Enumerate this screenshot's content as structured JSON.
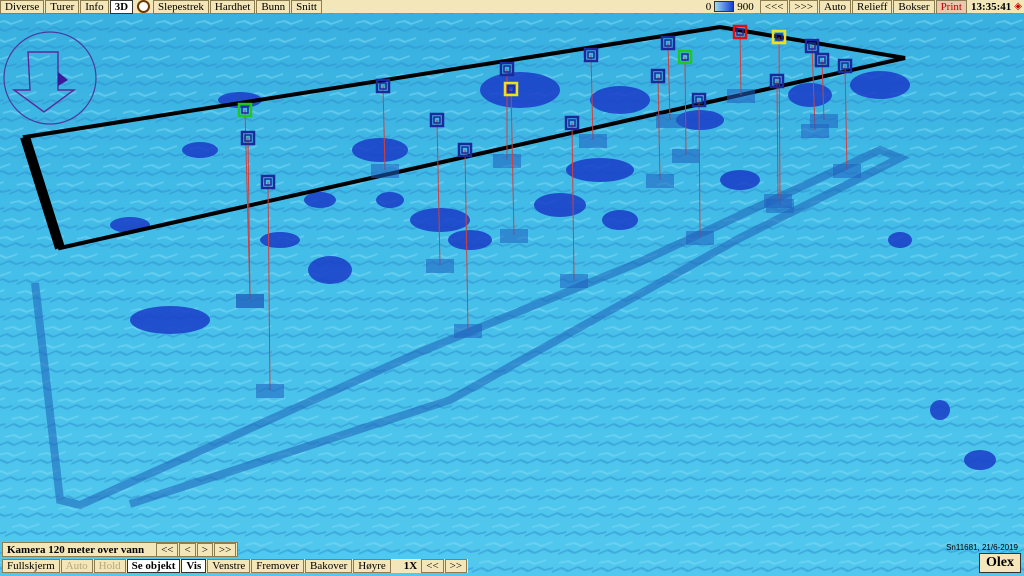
{
  "toolbar": {
    "left_buttons": [
      "Diverse",
      "Turer",
      "Info",
      "3D",
      "Slepestrek",
      "Hardhet",
      "Bunn",
      "Snitt"
    ],
    "depth_min": "0",
    "depth_max": "900",
    "right_buttons": [
      "<<<",
      ">>>",
      "Auto",
      "Relieff",
      "Bokser",
      "Print"
    ],
    "clock": "13:35:41",
    "gps_symbol": "◈"
  },
  "camera": {
    "label": "Kamera 120 meter over vann",
    "buttons": [
      "<<",
      "<",
      ">",
      ">>"
    ]
  },
  "bottom": {
    "buttons": [
      "Fullskjerm",
      "Auto",
      "Hold",
      "Se objekt",
      "Vis",
      "Venstre",
      "Fremover",
      "Bakover",
      "Høyre"
    ],
    "speed": "1X",
    "speed_buttons": [
      "<<",
      ">>"
    ]
  },
  "stamp": "Sn11681, 21/6-2019",
  "logo": "Olex",
  "colors": {
    "seabed_light": "#4cc6ec",
    "seabed_dark": "#1a3cc8",
    "toolbar_bg": "#f3e6b8",
    "marker_green": "#1ec81e",
    "marker_yellow": "#f0e020",
    "marker_red": "#e01010",
    "marker_blue": "#1a2a9a"
  },
  "icons": {
    "compass": "compass-arrow-icon"
  },
  "markers": [
    {
      "color": "green"
    },
    {
      "color": "blue"
    },
    {
      "color": "blue"
    },
    {
      "color": "blue"
    },
    {
      "color": "blue"
    },
    {
      "color": "blue"
    },
    {
      "color": "blue"
    },
    {
      "color": "yellow"
    },
    {
      "color": "blue"
    },
    {
      "color": "green"
    },
    {
      "color": "blue"
    },
    {
      "color": "blue"
    },
    {
      "color": "blue"
    },
    {
      "color": "red"
    },
    {
      "color": "yellow"
    },
    {
      "color": "blue"
    },
    {
      "color": "blue"
    },
    {
      "color": "blue"
    },
    {
      "color": "blue"
    },
    {
      "color": "blue"
    }
  ]
}
